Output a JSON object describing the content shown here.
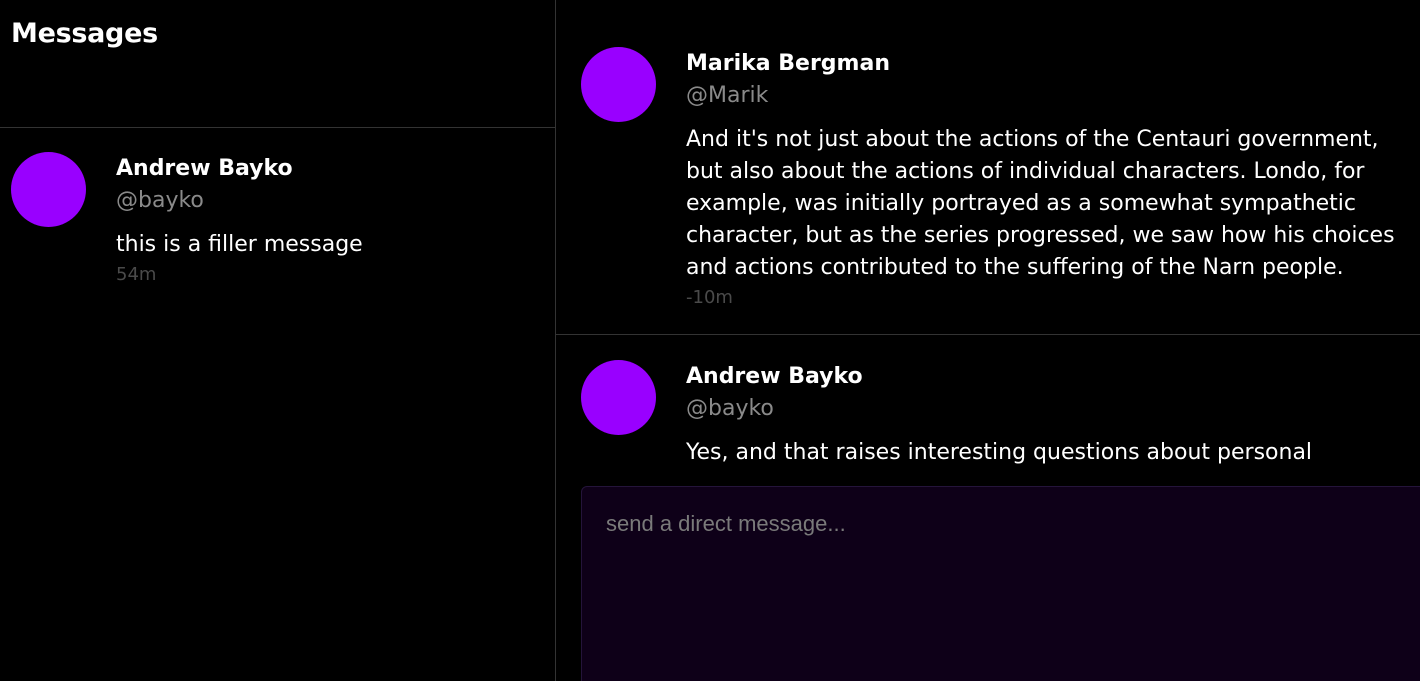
{
  "sidebar": {
    "title": "Messages",
    "conversations": [
      {
        "name": "Andrew Bayko",
        "handle": "@bayko",
        "preview": "this is a filler message",
        "time": "54m"
      }
    ]
  },
  "chat": {
    "messages": [
      {
        "name": "Marika Bergman",
        "handle": "@Marik",
        "text": "And it's not just about the actions of the Centauri government, but also about the actions of individual characters. Londo, for example, was initially portrayed as a somewhat sympathetic character, but as the series progressed, we saw how his choices and actions contributed to the suffering of the Narn people.",
        "time": "-10m"
      },
      {
        "name": "Andrew Bayko",
        "handle": "@bayko",
        "text": "Yes, and that raises interesting questions about personal"
      }
    ],
    "composer": {
      "placeholder": "send a direct message...",
      "value": ""
    }
  },
  "colors": {
    "background": "#000000",
    "avatar": "#9900ff",
    "divider": "#333333",
    "handle": "#8a8a8a",
    "timestamp": "#4a4a4a",
    "composer_bg": "#0e0018"
  }
}
